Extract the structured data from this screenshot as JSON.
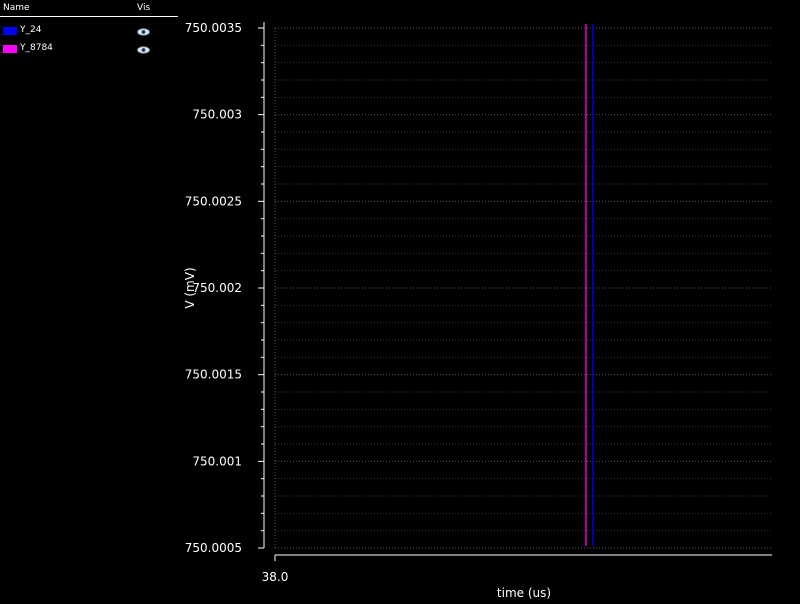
{
  "legend": {
    "header_name": "Name",
    "header_vis": "Vis",
    "items": [
      {
        "name": "Y_24",
        "color": "#0000ff",
        "icon": "eye-icon"
      },
      {
        "name": "Y_8784",
        "color": "#ff00ff",
        "icon": "eye-icon"
      }
    ]
  },
  "chart_data": {
    "type": "line",
    "title": "",
    "xlabel": "time (us)",
    "ylabel": "V (mV)",
    "xlim": [
      38.0,
      38.0
    ],
    "ylim": [
      750.0005,
      750.0035
    ],
    "x_ticks": [
      "38.0"
    ],
    "y_ticks": [
      "750.0035",
      "750.003",
      "750.0025",
      "750.002",
      "750.0015",
      "750.001",
      "750.0005"
    ],
    "grid": true,
    "background": "#000000",
    "axis_color": "#ffffff",
    "series": [
      {
        "name": "Y_24",
        "color": "#0000ff",
        "marks": "vertical-line"
      },
      {
        "name": "Y_8784",
        "color": "#ff00ff",
        "marks": "vertical-line"
      }
    ]
  }
}
